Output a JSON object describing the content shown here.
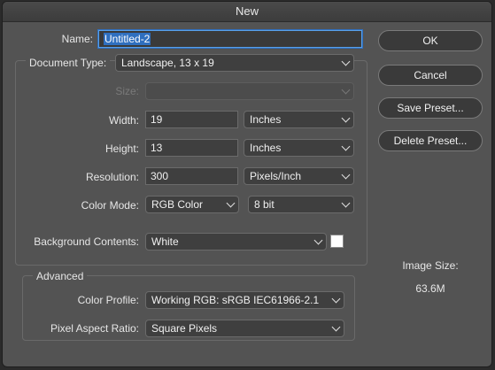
{
  "window": {
    "title": "New"
  },
  "form": {
    "name_label": "Name:",
    "name_value": "Untitled-2",
    "document_type_label": "Document Type:",
    "document_type_value": "Landscape, 13 x 19",
    "size_label": "Size:",
    "size_value": "",
    "width_label": "Width:",
    "width_value": "19",
    "width_unit": "Inches",
    "height_label": "Height:",
    "height_value": "13",
    "height_unit": "Inches",
    "resolution_label": "Resolution:",
    "resolution_value": "300",
    "resolution_unit": "Pixels/Inch",
    "color_mode_label": "Color Mode:",
    "color_mode_value": "RGB Color",
    "bit_depth_value": "8 bit",
    "background_label": "Background Contents:",
    "background_value": "White",
    "background_swatch_color": "#ffffff"
  },
  "advanced": {
    "legend": "Advanced",
    "color_profile_label": "Color Profile:",
    "color_profile_value": "Working RGB:  sRGB IEC61966-2.1",
    "pixel_aspect_label": "Pixel Aspect Ratio:",
    "pixel_aspect_value": "Square Pixels"
  },
  "buttons": {
    "ok": "OK",
    "cancel": "Cancel",
    "save_preset": "Save Preset...",
    "delete_preset": "Delete Preset..."
  },
  "image_size": {
    "label": "Image Size:",
    "value": "63.6M"
  },
  "colors": {
    "accent": "#2f6fbf",
    "dialog_bg": "#535353"
  }
}
